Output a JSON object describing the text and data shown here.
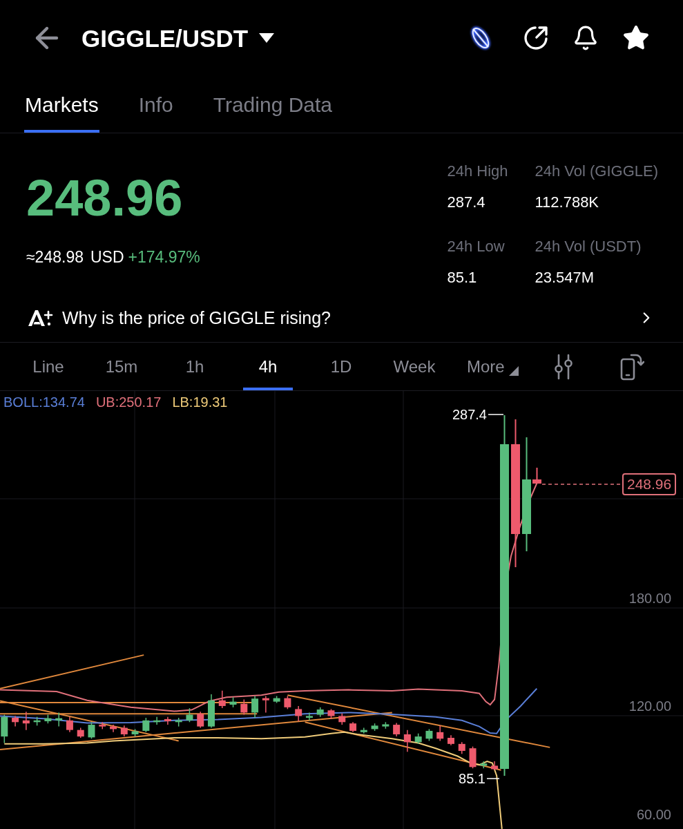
{
  "header": {
    "title": "GIGGLE/USDT"
  },
  "tabs": [
    {
      "label": "Markets",
      "selected": true
    },
    {
      "label": "Info",
      "selected": false
    },
    {
      "label": "Trading Data",
      "selected": false
    }
  ],
  "ticker": {
    "last_price": "248.96",
    "usd_value": "≈248.98",
    "usd_unit": "USD",
    "change": "+174.97%",
    "stats": [
      {
        "label": "24h High",
        "value": "287.4"
      },
      {
        "label": "24h Vol (GIGGLE)",
        "value": "112.788K"
      },
      {
        "label": "24h Low",
        "value": "85.1"
      },
      {
        "label": "24h Vol (USDT)",
        "value": "23.547M"
      }
    ]
  },
  "insight": {
    "text": "Why is the price of GIGGLE rising?"
  },
  "intervals": [
    {
      "label": "Line",
      "kind": "interval",
      "selected": false
    },
    {
      "label": "15m",
      "kind": "interval",
      "selected": false
    },
    {
      "label": "1h",
      "kind": "interval",
      "selected": false
    },
    {
      "label": "4h",
      "kind": "interval",
      "selected": true
    },
    {
      "label": "1D",
      "kind": "interval",
      "selected": false
    },
    {
      "label": "Week",
      "kind": "interval",
      "selected": false
    },
    {
      "label": "More",
      "kind": "menu",
      "selected": false
    }
  ],
  "chart": {
    "indicators": [
      {
        "label": "BOLL:134.74",
        "color": "#5a7fd8"
      },
      {
        "label": "UB:250.17",
        "color": "#e0707a"
      },
      {
        "label": "LB:19.31",
        "color": "#f0cc7a"
      }
    ],
    "price_labels": [
      "180.00",
      "120.00",
      "60.00"
    ],
    "high_marker": "287.4",
    "low_marker": "85.1",
    "last_price_tag": "248.96"
  }
}
